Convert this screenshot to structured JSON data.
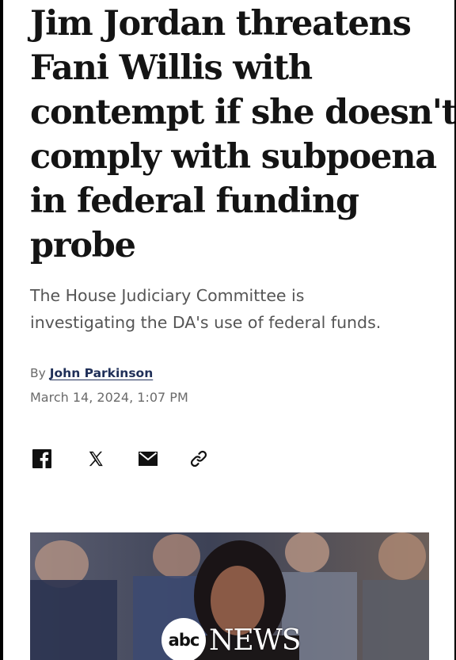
{
  "article": {
    "headline_lines": [
      "Jim Jordan threatens",
      "Fani Willis with",
      "contempt if she doesn't",
      "comply with subpoena",
      "in federal funding",
      "probe"
    ],
    "subhead_lines": [
      "The House Judiciary Committee is",
      "investigating the DA's use of federal funds."
    ],
    "byline_prefix": "By",
    "author": "John Parkinson",
    "date": "March 14, 2024, 1:07 PM"
  },
  "share": {
    "icons": [
      "facebook-icon",
      "x-icon",
      "email-icon",
      "link-icon"
    ]
  },
  "photo": {
    "logo_abc": "abc",
    "logo_news": "NEWS"
  },
  "colors": {
    "headline": "#141414",
    "subhead": "#555555",
    "author_link": "#1f2f58",
    "meta": "#6a6a6a"
  }
}
